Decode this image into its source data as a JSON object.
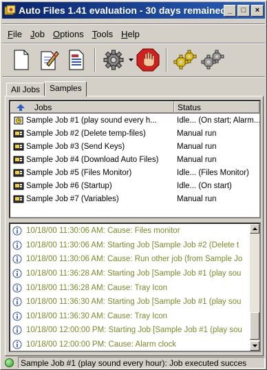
{
  "window": {
    "title": "Auto Files 1.41 evaluation - 30 days remained",
    "controls": [
      "_",
      "□",
      "×"
    ]
  },
  "menu": [
    {
      "key": "F",
      "rest": "ile"
    },
    {
      "key": "J",
      "rest": "ob"
    },
    {
      "key": "O",
      "rest": "ptions"
    },
    {
      "key": "T",
      "rest": "ools"
    },
    {
      "key": "H",
      "rest": "elp"
    }
  ],
  "toolbar": {
    "icons": [
      "new-job-icon",
      "edit-job-icon",
      "job-properties-icon",
      "settings-gear-icon",
      "dropdown-arrow-icon",
      "stop-hand-icon",
      "run-gears-icon",
      "run-all-gears-icon"
    ]
  },
  "tabs": [
    {
      "label": "All Jobs",
      "active": false
    },
    {
      "label": "Samples",
      "active": true
    }
  ],
  "jobs": {
    "columns": [
      "Jobs",
      "Status"
    ],
    "rows": [
      {
        "name": "Sample Job #1 (play sound every h...",
        "status": "Idle... (On start; Alarm..."
      },
      {
        "name": "Sample Job #2 (Delete temp-files)",
        "status": "Manual run"
      },
      {
        "name": "Sample Job #3 (Send Keys)",
        "status": "Manual run"
      },
      {
        "name": "Sample Job #4 (Download Auto Files)",
        "status": "Manual run"
      },
      {
        "name": "Sample Job #5 (Files Monitor)",
        "status": "Idle... (Files Monitor)"
      },
      {
        "name": "Sample Job #6 (Startup)",
        "status": "Idle... (On start)"
      },
      {
        "name": "Sample Job #7 (Variables)",
        "status": "Manual run"
      }
    ]
  },
  "log": [
    "10/18/00 11:30:06 AM: Cause: Files monitor",
    "10/18/00 11:30:06 AM: Starting Job [Sample Job #2 (Delete t",
    "10/18/00 11:30:06 AM: Cause: Run other job (from Sample Jo",
    "10/18/00 11:36:28 AM: Starting Job [Sample Job #1 (play sou",
    "10/18/00 11:36:28 AM: Cause: Tray Icon",
    "10/18/00 11:36:30 AM: Starting Job [Sample Job #1 (play sou",
    "10/18/00 11:36:30 AM: Cause: Tray Icon",
    "10/18/00 12:00:00 PM: Starting Job [Sample Job #1 (play sou",
    "10/18/00 12:00:00 PM: Cause: Alarm clock"
  ],
  "status": {
    "text": "Sample Job #1 (play sound every hour): Job executed succes"
  }
}
